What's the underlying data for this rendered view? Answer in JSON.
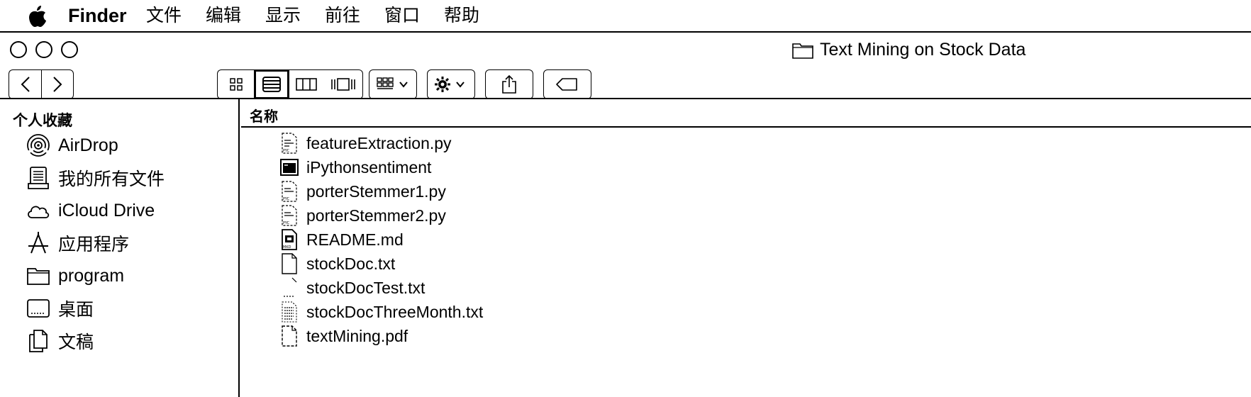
{
  "menubar": {
    "apple_icon": "apple-logo-icon",
    "app_name": "Finder",
    "items": [
      "文件",
      "编辑",
      "显示",
      "前往",
      "窗口",
      "帮助"
    ]
  },
  "window": {
    "title": "Text Mining on Stock Data",
    "title_icon": "folder-icon"
  },
  "toolbar": {
    "back_icon": "chevron-left-icon",
    "forward_icon": "chevron-right-icon",
    "views": [
      "icon-view-icon",
      "list-view-icon",
      "column-view-icon",
      "gallery-view-icon"
    ],
    "active_view": "list-view-icon",
    "group_icon": "group-by-icon",
    "action_icon": "gear-icon",
    "share_icon": "share-icon",
    "tag_icon": "tag-icon"
  },
  "sidebar": {
    "header": "个人收藏",
    "items": [
      {
        "label": "AirDrop",
        "icon": "airdrop-icon"
      },
      {
        "label": "我的所有文件",
        "icon": "all-files-icon"
      },
      {
        "label": "iCloud Drive",
        "icon": "cloud-icon"
      },
      {
        "label": "应用程序",
        "icon": "applications-icon"
      },
      {
        "label": "program",
        "icon": "folder-icon"
      },
      {
        "label": "桌面",
        "icon": "desktop-icon"
      },
      {
        "label": "文稿",
        "icon": "documents-icon"
      }
    ]
  },
  "list": {
    "column_name": "名称",
    "files": [
      {
        "name": "featureExtraction.py",
        "icon": "python-file-icon"
      },
      {
        "name": "iPythonsentiment",
        "icon": "executable-icon"
      },
      {
        "name": "porterStemmer1.py",
        "icon": "python-file-icon"
      },
      {
        "name": "porterStemmer2.py",
        "icon": "python-file-icon"
      },
      {
        "name": "README.md",
        "icon": "markdown-file-icon"
      },
      {
        "name": "stockDoc.txt",
        "icon": "text-file-icon"
      },
      {
        "name": "stockDocTest.txt",
        "icon": "text-file-icon"
      },
      {
        "name": "stockDocThreeMonth.txt",
        "icon": "text-file-icon"
      },
      {
        "name": "textMining.pdf",
        "icon": "pdf-file-icon"
      }
    ]
  }
}
